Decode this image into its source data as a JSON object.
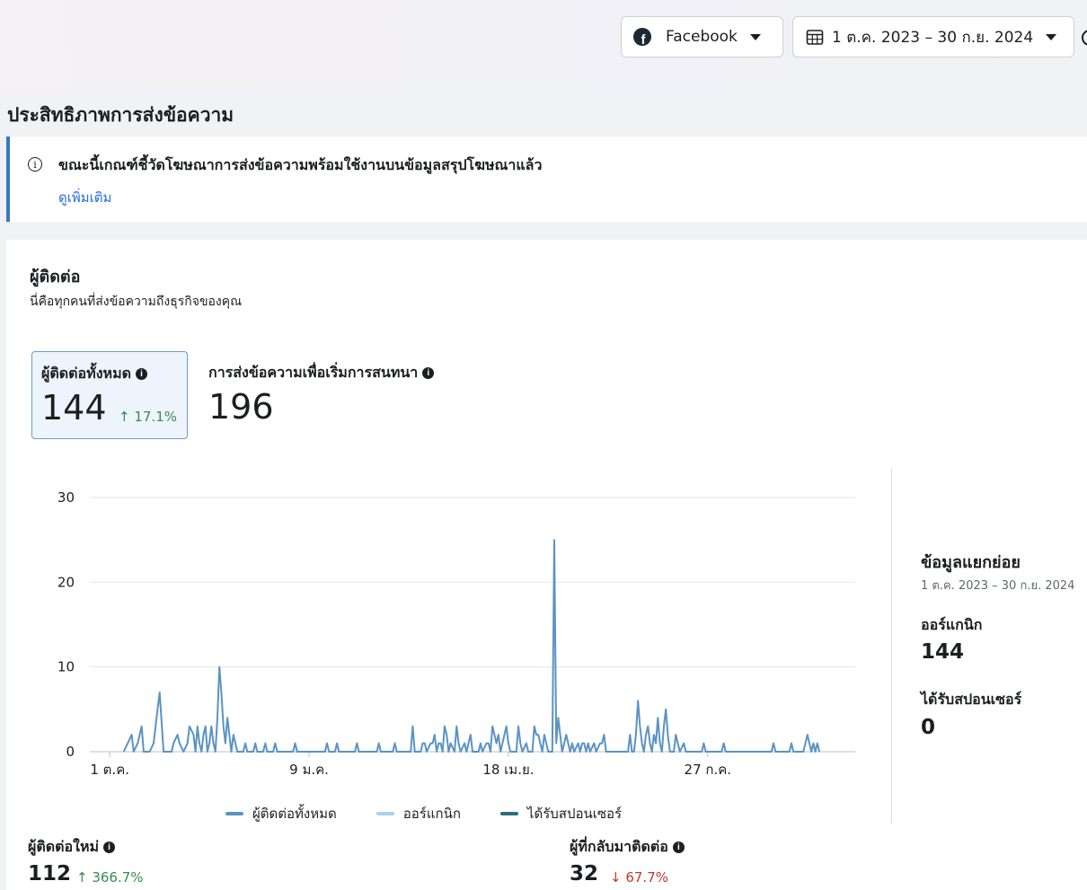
{
  "header": {
    "platform": "Facebook",
    "date_range": "1 ต.ค. 2023 – 30 ก.ย. 2024"
  },
  "section_title": "ประสิทธิภาพการส่งข้อความ",
  "notice": {
    "text": "ขณะนี้เกณฑ์ชี้วัดโฆษณาการส่งข้อความพร้อมใช้งานบนข้อมูลสรุปโฆษณาแล้ว",
    "link": "ดูเพิ่มเติม"
  },
  "contacts": {
    "title": "ผู้ติดต่อ",
    "subtitle": "นี่คือทุกคนที่ส่งข้อความถึงธุรกิจของคุณ"
  },
  "metrics": {
    "total_contacts": {
      "label": "ผู้ติดต่อทั้งหมด",
      "value": "144",
      "change": "↑ 17.1%"
    },
    "conversations_started": {
      "label": "การส่งข้อความเพื่อเริ่มการสนทนา",
      "value": "196"
    },
    "new_contacts": {
      "label": "ผู้ติดต่อใหม่",
      "value": "112",
      "change": "↑ 366.7%"
    },
    "returning_contacts": {
      "label": "ผู้ที่กลับมาติดต่อ",
      "value": "32",
      "change": "↓ 67.7%"
    }
  },
  "breakdown": {
    "title": "ข้อมูลแยกย่อย",
    "range": "1 ต.ค. 2023 – 30 ก.ย. 2024",
    "organic_label": "ออร์แกนิก",
    "organic_value": "144",
    "sponsored_label": "ได้รับสปอนเซอร์",
    "sponsored_value": "0"
  },
  "colors": {
    "total": "#5b93c4",
    "organic": "#a8d1ee",
    "sponsored": "#2e6e78"
  },
  "chart_data": {
    "type": "line",
    "x_tick_labels": [
      "1 ต.ค.",
      "9 ม.ค.",
      "18 เม.ย.",
      "27 ก.ค."
    ],
    "x_tick_days": [
      1,
      101,
      201,
      301
    ],
    "x_range": [
      -9,
      375
    ],
    "ylim": [
      0,
      30
    ],
    "y_ticks": [
      0,
      10,
      20,
      30
    ],
    "grid": true,
    "legend_position": "bottom",
    "series": [
      {
        "name": "ผู้ติดต่อทั้งหมด",
        "color": "#5b93c4",
        "points": [
          [
            8,
            0
          ],
          [
            10,
            1
          ],
          [
            12,
            2
          ],
          [
            13,
            0
          ],
          [
            15,
            1
          ],
          [
            17,
            3
          ],
          [
            18,
            0
          ],
          [
            21,
            0
          ],
          [
            23,
            1
          ],
          [
            25,
            5
          ],
          [
            26,
            7
          ],
          [
            28,
            0
          ],
          [
            32,
            0
          ],
          [
            33,
            1
          ],
          [
            35,
            2
          ],
          [
            36,
            1
          ],
          [
            38,
            0
          ],
          [
            40,
            1
          ],
          [
            41,
            3
          ],
          [
            43,
            2
          ],
          [
            44,
            0
          ],
          [
            45,
            3
          ],
          [
            46,
            1
          ],
          [
            47,
            0
          ],
          [
            48,
            2
          ],
          [
            49,
            3
          ],
          [
            50,
            0
          ],
          [
            51,
            1
          ],
          [
            52,
            3
          ],
          [
            53,
            1
          ],
          [
            54,
            0
          ],
          [
            55,
            4
          ],
          [
            56,
            10
          ],
          [
            57,
            7
          ],
          [
            58,
            3
          ],
          [
            59,
            1
          ],
          [
            60,
            4
          ],
          [
            61,
            2
          ],
          [
            62,
            0
          ],
          [
            63,
            2
          ],
          [
            64,
            1
          ],
          [
            65,
            0
          ],
          [
            68,
            0
          ],
          [
            69,
            1
          ],
          [
            70,
            0
          ],
          [
            73,
            0
          ],
          [
            74,
            1
          ],
          [
            75,
            0
          ],
          [
            78,
            0
          ],
          [
            79,
            1
          ],
          [
            80,
            0
          ],
          [
            83,
            0
          ],
          [
            84,
            1
          ],
          [
            85,
            0
          ],
          [
            93,
            0
          ],
          [
            94,
            1
          ],
          [
            95,
            0
          ],
          [
            109,
            0
          ],
          [
            110,
            1
          ],
          [
            111,
            0
          ],
          [
            114,
            0
          ],
          [
            115,
            1
          ],
          [
            116,
            0
          ],
          [
            124,
            0
          ],
          [
            125,
            1
          ],
          [
            126,
            0
          ],
          [
            135,
            0
          ],
          [
            136,
            1
          ],
          [
            137,
            0
          ],
          [
            143,
            0
          ],
          [
            144,
            1
          ],
          [
            145,
            0
          ],
          [
            152,
            0
          ],
          [
            153,
            3
          ],
          [
            154,
            0
          ],
          [
            157,
            0
          ],
          [
            158,
            1
          ],
          [
            159,
            1
          ],
          [
            160,
            0
          ],
          [
            162,
            1
          ],
          [
            163,
            1
          ],
          [
            164,
            2
          ],
          [
            165,
            0
          ],
          [
            166,
            1
          ],
          [
            167,
            1
          ],
          [
            168,
            0
          ],
          [
            169,
            3
          ],
          [
            170,
            2
          ],
          [
            171,
            0
          ],
          [
            172,
            1
          ],
          [
            174,
            0
          ],
          [
            175,
            3
          ],
          [
            176,
            1
          ],
          [
            177,
            0
          ],
          [
            179,
            1
          ],
          [
            180,
            0
          ],
          [
            182,
            2
          ],
          [
            183,
            0
          ],
          [
            186,
            0
          ],
          [
            187,
            1
          ],
          [
            188,
            0
          ],
          [
            190,
            1
          ],
          [
            191,
            1
          ],
          [
            192,
            0
          ],
          [
            193,
            3
          ],
          [
            194,
            2
          ],
          [
            195,
            1
          ],
          [
            196,
            2
          ],
          [
            197,
            0
          ],
          [
            198,
            1
          ],
          [
            199,
            2
          ],
          [
            200,
            3
          ],
          [
            201,
            1
          ],
          [
            202,
            0
          ],
          [
            205,
            0
          ],
          [
            206,
            3
          ],
          [
            207,
            1
          ],
          [
            208,
            0
          ],
          [
            210,
            1
          ],
          [
            211,
            0
          ],
          [
            213,
            0
          ],
          [
            214,
            3
          ],
          [
            215,
            2
          ],
          [
            216,
            2
          ],
          [
            217,
            1
          ],
          [
            218,
            0
          ],
          [
            219,
            2
          ],
          [
            220,
            1
          ],
          [
            221,
            0
          ],
          [
            223,
            0
          ],
          [
            224,
            25
          ],
          [
            225,
            1
          ],
          [
            226,
            4
          ],
          [
            227,
            2
          ],
          [
            228,
            0
          ],
          [
            229,
            1
          ],
          [
            230,
            2
          ],
          [
            231,
            1
          ],
          [
            232,
            0
          ],
          [
            233,
            1
          ],
          [
            234,
            0
          ],
          [
            236,
            1
          ],
          [
            237,
            0
          ],
          [
            238,
            1
          ],
          [
            239,
            1
          ],
          [
            240,
            0
          ],
          [
            241,
            1
          ],
          [
            242,
            0
          ],
          [
            244,
            1
          ],
          [
            245,
            0
          ],
          [
            247,
            1
          ],
          [
            248,
            1
          ],
          [
            249,
            2
          ],
          [
            250,
            0
          ],
          [
            261,
            0
          ],
          [
            262,
            2
          ],
          [
            263,
            0
          ],
          [
            264,
            0
          ],
          [
            265,
            2
          ],
          [
            266,
            6
          ],
          [
            267,
            3
          ],
          [
            268,
            1
          ],
          [
            269,
            0
          ],
          [
            270,
            2
          ],
          [
            271,
            3
          ],
          [
            272,
            1
          ],
          [
            273,
            0
          ],
          [
            274,
            2
          ],
          [
            275,
            1
          ],
          [
            276,
            4
          ],
          [
            277,
            1
          ],
          [
            278,
            0
          ],
          [
            279,
            3
          ],
          [
            280,
            5
          ],
          [
            281,
            2
          ],
          [
            282,
            0
          ],
          [
            284,
            0
          ],
          [
            285,
            2
          ],
          [
            286,
            1
          ],
          [
            287,
            0
          ],
          [
            289,
            1
          ],
          [
            290,
            0
          ],
          [
            298,
            0
          ],
          [
            299,
            1
          ],
          [
            300,
            0
          ],
          [
            308,
            0
          ],
          [
            309,
            1
          ],
          [
            310,
            0
          ],
          [
            333,
            0
          ],
          [
            334,
            1
          ],
          [
            335,
            0
          ],
          [
            342,
            0
          ],
          [
            343,
            1
          ],
          [
            344,
            0
          ],
          [
            349,
            0
          ],
          [
            350,
            1
          ],
          [
            351,
            2
          ],
          [
            352,
            1
          ],
          [
            353,
            0
          ],
          [
            354,
            1
          ],
          [
            355,
            0
          ],
          [
            356,
            1
          ],
          [
            357,
            0
          ]
        ]
      },
      {
        "name": "ออร์แกนิก",
        "color": "#a8d1ee",
        "points": []
      },
      {
        "name": "ได้รับสปอนเซอร์",
        "color": "#2e6e78",
        "points": []
      }
    ]
  }
}
